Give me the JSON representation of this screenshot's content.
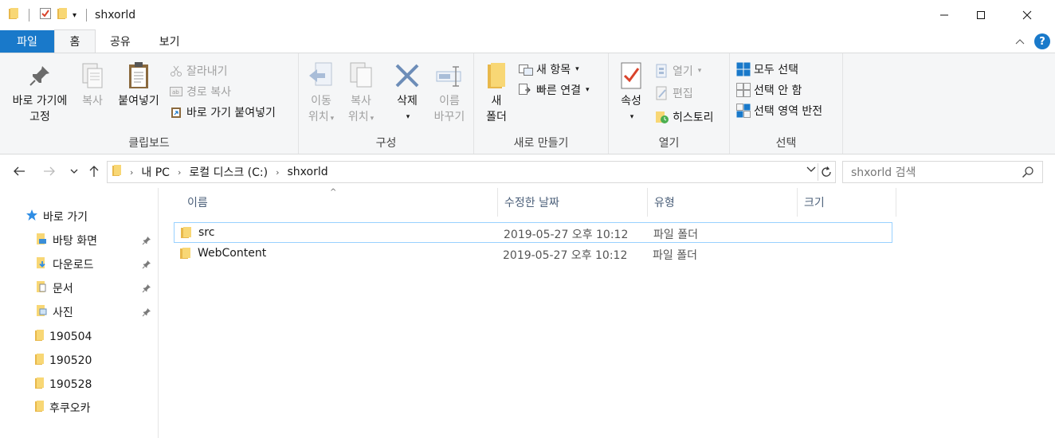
{
  "window": {
    "title": "shxorld",
    "controls": [
      "minimize",
      "maximize",
      "close"
    ]
  },
  "tabs": [
    {
      "label": "파일"
    },
    {
      "label": "홈"
    },
    {
      "label": "공유"
    },
    {
      "label": "보기"
    }
  ],
  "ribbon": {
    "clipboard": {
      "label": "클립보드",
      "pin_line1": "바로 가기에",
      "pin_line2": "고정",
      "copy": "복사",
      "paste": "붙여넣기",
      "cut": "잘라내기",
      "copy_path": "경로 복사",
      "paste_shortcut": "바로 가기 붙여넣기"
    },
    "organize": {
      "label": "구성",
      "move_line1": "이동",
      "move_line2": "위치",
      "copyto_line1": "복사",
      "copyto_line2": "위치",
      "delete": "삭제",
      "rename_line1": "이름",
      "rename_line2": "바꾸기"
    },
    "new": {
      "label": "새로 만들기",
      "newfolder_line1": "새",
      "newfolder_line2": "폴더",
      "new_item": "새 항목",
      "easy_access": "빠른 연결"
    },
    "open": {
      "label": "열기",
      "properties": "속성",
      "open": "열기",
      "edit": "편집",
      "history": "히스토리"
    },
    "select": {
      "label": "선택",
      "select_all": "모두 선택",
      "select_none": "선택 안 함",
      "invert": "선택 영역 반전"
    }
  },
  "address": {
    "crumbs": [
      "내 PC",
      "로컬 디스크 (C:)",
      "shxorld"
    ],
    "search_placeholder": "shxorld 검색"
  },
  "nav": {
    "quick_access": "바로 가기",
    "items": [
      {
        "label": "바탕 화면",
        "pinned": true
      },
      {
        "label": "다운로드",
        "pinned": true
      },
      {
        "label": "문서",
        "pinned": true
      },
      {
        "label": "사진",
        "pinned": true
      },
      {
        "label": "190504",
        "pinned": false
      },
      {
        "label": "190520",
        "pinned": false
      },
      {
        "label": "190528",
        "pinned": false
      },
      {
        "label": "후쿠오카",
        "pinned": false
      }
    ]
  },
  "columns": [
    "이름",
    "수정한 날짜",
    "유형",
    "크기"
  ],
  "files": [
    {
      "name": "src",
      "date": "2019-05-27 오후 10:12",
      "type": "파일 폴더",
      "size": ""
    },
    {
      "name": "WebContent",
      "date": "2019-05-27 오후 10:12",
      "type": "파일 폴더",
      "size": ""
    }
  ],
  "colors": {
    "accent": "#1979ca",
    "folder": "#f8d775",
    "selection_border": "#99d1ff"
  }
}
